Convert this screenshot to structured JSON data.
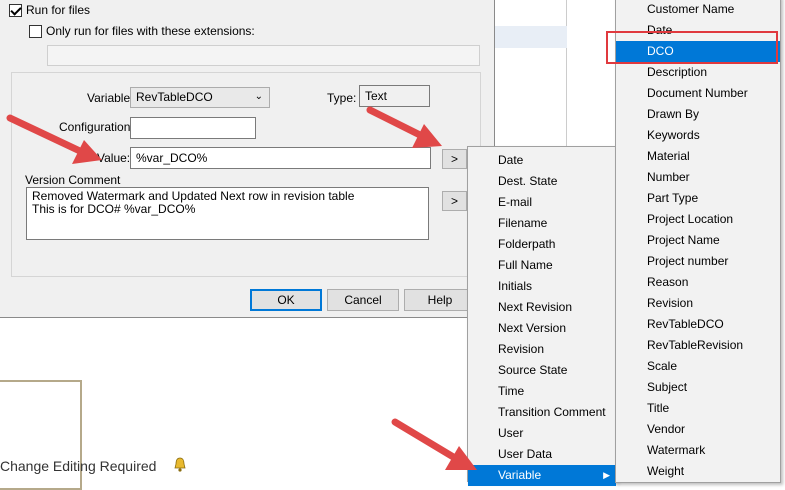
{
  "dialog": {
    "run_for_files": "Run for files",
    "only_run_ext": "Only run for files with these extensions:",
    "variable_label": "Variable:",
    "variable_value": "RevTableDCO",
    "type_label": "Type:",
    "type_value": "Text",
    "configuration_label": "Configuration:",
    "configuration_value": "",
    "value_label": "Value:",
    "value_value": "%var_DCO%",
    "expand_btn": ">",
    "version_comment_label": "Version Comment",
    "version_comment_value": "Removed Watermark and Updated Next row in revision table\nThis is for DCO# %var_DCO%",
    "ok": "OK",
    "cancel": "Cancel",
    "help": "Help"
  },
  "background": {
    "change_editing": "Change Editing Required"
  },
  "menu1": {
    "items": [
      "Date",
      "Dest. State",
      "E-mail",
      "Filename",
      "Folderpath",
      "Full Name",
      "Initials",
      "Next Revision",
      "Next Version",
      "Revision",
      "Source State",
      "Time",
      "Transition Comment",
      "User",
      "User Data",
      "Variable"
    ],
    "selected": "Variable"
  },
  "menu2": {
    "items": [
      "Customer Name",
      "Date",
      "DCO",
      "Description",
      "Document Number",
      "Drawn By",
      "Keywords",
      "Material",
      "Number",
      "Part Type",
      "Project Location",
      "Project Name",
      "Project number",
      "Reason",
      "Revision",
      "RevTableDCO",
      "RevTableRevision",
      "Scale",
      "Subject",
      "Title",
      "Vendor",
      "Watermark",
      "Weight"
    ],
    "selected": "DCO"
  },
  "colors": {
    "accent": "#0078d7",
    "highlight_box": "#e0393e",
    "arrow": "#e04848"
  }
}
